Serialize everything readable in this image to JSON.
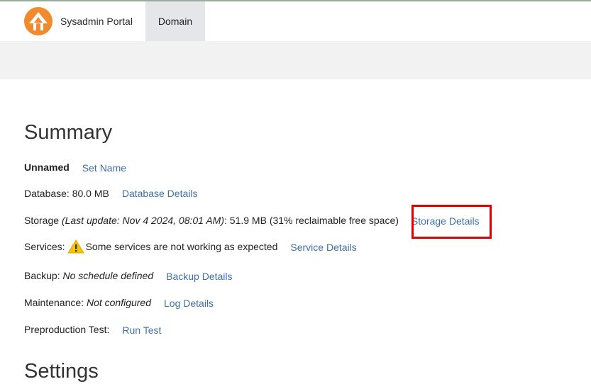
{
  "header": {
    "brand": "Sysadmin Portal",
    "tabs": [
      {
        "label": "Domain",
        "active": true
      }
    ]
  },
  "summary": {
    "title": "Summary",
    "name": {
      "value": "Unnamed",
      "link": "Set Name"
    },
    "database": {
      "label": "Database: 80.0 MB",
      "link": "Database Details"
    },
    "storage": {
      "label": "Storage",
      "last_update": "(Last update: Nov 4 2024, 08:01 AM)",
      "value": ": 51.9 MB (31% reclaimable free space)",
      "link": "Storage Details"
    },
    "services": {
      "label": "Services:",
      "status": "Some services are not working as expected",
      "link": "Service Details",
      "icon": "warning-icon"
    },
    "backup": {
      "label": "Backup:",
      "value": "No schedule defined",
      "link": "Backup Details"
    },
    "maintenance": {
      "label": "Maintenance:",
      "value": "Not configured",
      "link": "Log Details"
    },
    "preproduction": {
      "label": "Preproduction Test:",
      "link": "Run Test"
    }
  },
  "settings": {
    "title": "Settings"
  },
  "colors": {
    "link": "#3f6fa8",
    "highlight": "#e00000",
    "logo": "#f08a2c",
    "warning": "#f5c400"
  }
}
